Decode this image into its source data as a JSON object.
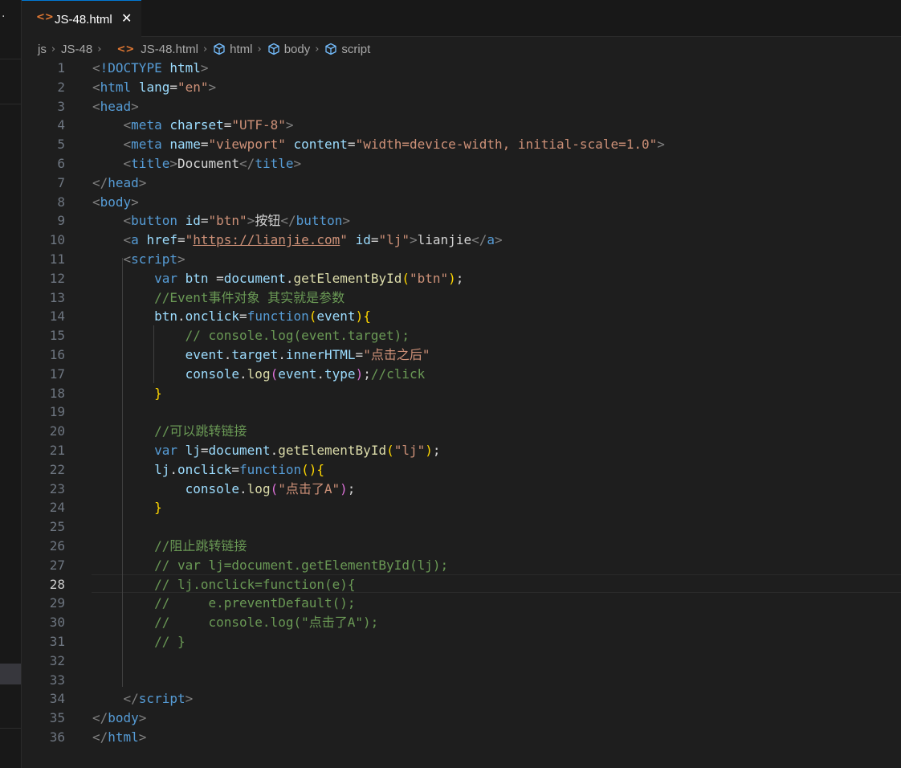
{
  "tab": {
    "icon": "<>",
    "label": "JS-48.html",
    "close": "✕"
  },
  "breadcrumb": [
    {
      "label": "js",
      "icon": null
    },
    {
      "label": "JS-48",
      "icon": null
    },
    {
      "label": "JS-48.html",
      "icon": "html-file-icon"
    },
    {
      "label": "html",
      "icon": "symbol-element-icon"
    },
    {
      "label": "body",
      "icon": "symbol-element-icon"
    },
    {
      "label": "script",
      "icon": "symbol-element-icon"
    }
  ],
  "editor": {
    "active_line": 28,
    "lines": [
      {
        "n": "1",
        "indent": 0,
        "tokens": [
          [
            "punc",
            "<"
          ],
          [
            "tag",
            "!DOCTYPE"
          ],
          [
            "text",
            " "
          ],
          [
            "attr",
            "html"
          ],
          [
            "punc",
            ">"
          ]
        ]
      },
      {
        "n": "2",
        "indent": 0,
        "tokens": [
          [
            "punc",
            "<"
          ],
          [
            "tag",
            "html"
          ],
          [
            "text",
            " "
          ],
          [
            "attr",
            "lang"
          ],
          [
            "text",
            "="
          ],
          [
            "str",
            "\"en\""
          ],
          [
            "punc",
            ">"
          ]
        ]
      },
      {
        "n": "3",
        "indent": 0,
        "tokens": [
          [
            "punc",
            "<"
          ],
          [
            "tag",
            "head"
          ],
          [
            "punc",
            ">"
          ]
        ]
      },
      {
        "n": "4",
        "indent": 1,
        "tokens": [
          [
            "punc",
            "<"
          ],
          [
            "tag",
            "meta"
          ],
          [
            "text",
            " "
          ],
          [
            "attr",
            "charset"
          ],
          [
            "text",
            "="
          ],
          [
            "str",
            "\"UTF-8\""
          ],
          [
            "punc",
            ">"
          ]
        ]
      },
      {
        "n": "5",
        "indent": 1,
        "tokens": [
          [
            "punc",
            "<"
          ],
          [
            "tag",
            "meta"
          ],
          [
            "text",
            " "
          ],
          [
            "attr",
            "name"
          ],
          [
            "text",
            "="
          ],
          [
            "str",
            "\"viewport\""
          ],
          [
            "text",
            " "
          ],
          [
            "attr",
            "content"
          ],
          [
            "text",
            "="
          ],
          [
            "str",
            "\"width=device-width, initial-scale=1.0\""
          ],
          [
            "punc",
            ">"
          ]
        ]
      },
      {
        "n": "6",
        "indent": 1,
        "tokens": [
          [
            "punc",
            "<"
          ],
          [
            "tag",
            "title"
          ],
          [
            "punc",
            ">"
          ],
          [
            "text",
            "Document"
          ],
          [
            "punc",
            "</"
          ],
          [
            "tag",
            "title"
          ],
          [
            "punc",
            ">"
          ]
        ]
      },
      {
        "n": "7",
        "indent": 0,
        "tokens": [
          [
            "punc",
            "</"
          ],
          [
            "tag",
            "head"
          ],
          [
            "punc",
            ">"
          ]
        ]
      },
      {
        "n": "8",
        "indent": 0,
        "tokens": [
          [
            "punc",
            "<"
          ],
          [
            "tag",
            "body"
          ],
          [
            "punc",
            ">"
          ]
        ]
      },
      {
        "n": "9",
        "indent": 1,
        "tokens": [
          [
            "punc",
            "<"
          ],
          [
            "tag",
            "button"
          ],
          [
            "text",
            " "
          ],
          [
            "attr",
            "id"
          ],
          [
            "text",
            "="
          ],
          [
            "str",
            "\"btn\""
          ],
          [
            "punc",
            ">"
          ],
          [
            "text",
            "按钮"
          ],
          [
            "punc",
            "</"
          ],
          [
            "tag",
            "button"
          ],
          [
            "punc",
            ">"
          ]
        ]
      },
      {
        "n": "10",
        "indent": 1,
        "tokens": [
          [
            "punc",
            "<"
          ],
          [
            "tag",
            "a"
          ],
          [
            "text",
            " "
          ],
          [
            "attr",
            "href"
          ],
          [
            "text",
            "="
          ],
          [
            "str",
            "\""
          ],
          [
            "link",
            "https://lianjie.com"
          ],
          [
            "str",
            "\""
          ],
          [
            "text",
            " "
          ],
          [
            "attr",
            "id"
          ],
          [
            "text",
            "="
          ],
          [
            "str",
            "\"lj\""
          ],
          [
            "punc",
            ">"
          ],
          [
            "text",
            "lianjie"
          ],
          [
            "punc",
            "</"
          ],
          [
            "tag",
            "a"
          ],
          [
            "punc",
            ">"
          ]
        ]
      },
      {
        "n": "11",
        "indent": 1,
        "tokens": [
          [
            "punc",
            "<"
          ],
          [
            "tag",
            "script"
          ],
          [
            "punc",
            ">"
          ]
        ]
      },
      {
        "n": "12",
        "indent": 2,
        "tokens": [
          [
            "kw",
            "var"
          ],
          [
            "text",
            " "
          ],
          [
            "var",
            "btn"
          ],
          [
            "text",
            " ="
          ],
          [
            "var",
            "document"
          ],
          [
            "text",
            "."
          ],
          [
            "fn",
            "getElementById"
          ],
          [
            "br1",
            "("
          ],
          [
            "str",
            "\"btn\""
          ],
          [
            "br1",
            ")"
          ],
          [
            "text",
            ";"
          ]
        ]
      },
      {
        "n": "13",
        "indent": 2,
        "tokens": [
          [
            "comment",
            "//Event事件对象 其实就是参数"
          ]
        ]
      },
      {
        "n": "14",
        "indent": 2,
        "tokens": [
          [
            "var",
            "btn"
          ],
          [
            "text",
            "."
          ],
          [
            "var",
            "onclick"
          ],
          [
            "text",
            "="
          ],
          [
            "kw",
            "function"
          ],
          [
            "br1",
            "("
          ],
          [
            "var",
            "event"
          ],
          [
            "br1",
            ")"
          ],
          [
            "br1",
            "{"
          ]
        ]
      },
      {
        "n": "15",
        "indent": 3,
        "tokens": [
          [
            "comment",
            "// console.log(event.target);"
          ]
        ]
      },
      {
        "n": "16",
        "indent": 3,
        "tokens": [
          [
            "var",
            "event"
          ],
          [
            "text",
            "."
          ],
          [
            "var",
            "target"
          ],
          [
            "text",
            "."
          ],
          [
            "var",
            "innerHTML"
          ],
          [
            "text",
            "="
          ],
          [
            "str",
            "\"点击之后\""
          ]
        ]
      },
      {
        "n": "17",
        "indent": 3,
        "tokens": [
          [
            "var",
            "console"
          ],
          [
            "text",
            "."
          ],
          [
            "fn",
            "log"
          ],
          [
            "br2",
            "("
          ],
          [
            "var",
            "event"
          ],
          [
            "text",
            "."
          ],
          [
            "var",
            "type"
          ],
          [
            "br2",
            ")"
          ],
          [
            "text",
            ";"
          ],
          [
            "comment",
            "//click"
          ]
        ]
      },
      {
        "n": "18",
        "indent": 2,
        "tokens": [
          [
            "br1",
            "}"
          ]
        ]
      },
      {
        "n": "19",
        "indent": 0,
        "tokens": []
      },
      {
        "n": "20",
        "indent": 2,
        "tokens": [
          [
            "comment",
            "//可以跳转链接"
          ]
        ]
      },
      {
        "n": "21",
        "indent": 2,
        "tokens": [
          [
            "kw",
            "var"
          ],
          [
            "text",
            " "
          ],
          [
            "var",
            "lj"
          ],
          [
            "text",
            "="
          ],
          [
            "var",
            "document"
          ],
          [
            "text",
            "."
          ],
          [
            "fn",
            "getElementById"
          ],
          [
            "br1",
            "("
          ],
          [
            "str",
            "\"lj\""
          ],
          [
            "br1",
            ")"
          ],
          [
            "text",
            ";"
          ]
        ]
      },
      {
        "n": "22",
        "indent": 2,
        "tokens": [
          [
            "var",
            "lj"
          ],
          [
            "text",
            "."
          ],
          [
            "var",
            "onclick"
          ],
          [
            "text",
            "="
          ],
          [
            "kw",
            "function"
          ],
          [
            "br1",
            "("
          ],
          [
            "br1",
            ")"
          ],
          [
            "br1",
            "{"
          ]
        ]
      },
      {
        "n": "23",
        "indent": 3,
        "tokens": [
          [
            "var",
            "console"
          ],
          [
            "text",
            "."
          ],
          [
            "fn",
            "log"
          ],
          [
            "br2",
            "("
          ],
          [
            "str",
            "\"点击了A\""
          ],
          [
            "br2",
            ")"
          ],
          [
            "text",
            ";"
          ]
        ]
      },
      {
        "n": "24",
        "indent": 2,
        "tokens": [
          [
            "br1",
            "}"
          ]
        ]
      },
      {
        "n": "25",
        "indent": 0,
        "tokens": []
      },
      {
        "n": "26",
        "indent": 2,
        "tokens": [
          [
            "comment",
            "//阻止跳转链接"
          ]
        ]
      },
      {
        "n": "27",
        "indent": 2,
        "tokens": [
          [
            "comment",
            "// var lj=document.getElementById(lj);"
          ]
        ]
      },
      {
        "n": "28",
        "indent": 2,
        "tokens": [
          [
            "comment",
            "// lj.onclick=function(e){"
          ]
        ]
      },
      {
        "n": "29",
        "indent": 2,
        "tokens": [
          [
            "comment",
            "//     e.preventDefault();"
          ]
        ]
      },
      {
        "n": "30",
        "indent": 2,
        "tokens": [
          [
            "comment",
            "//     console.log(\"点击了A\");"
          ]
        ]
      },
      {
        "n": "31",
        "indent": 2,
        "tokens": [
          [
            "comment",
            "// }"
          ]
        ]
      },
      {
        "n": "32",
        "indent": 0,
        "tokens": []
      },
      {
        "n": "33",
        "indent": 0,
        "tokens": []
      },
      {
        "n": "34",
        "indent": 1,
        "tokens": [
          [
            "punc",
            "</"
          ],
          [
            "tag",
            "script"
          ],
          [
            "punc",
            ">"
          ]
        ]
      },
      {
        "n": "35",
        "indent": 0,
        "tokens": [
          [
            "punc",
            "</"
          ],
          [
            "tag",
            "body"
          ],
          [
            "punc",
            ">"
          ]
        ]
      },
      {
        "n": "36",
        "indent": 0,
        "tokens": [
          [
            "punc",
            "</"
          ],
          [
            "tag",
            "html"
          ],
          [
            "punc",
            ">"
          ]
        ]
      }
    ]
  },
  "colors": {
    "editor_bg": "#1e1e1e",
    "tab_accent": "#0078d4",
    "html_icon": "#e37933",
    "keyword": "#569cd6",
    "attribute": "#9cdcfe",
    "string": "#ce9178",
    "comment": "#6a9955",
    "function": "#dcdcaa"
  }
}
